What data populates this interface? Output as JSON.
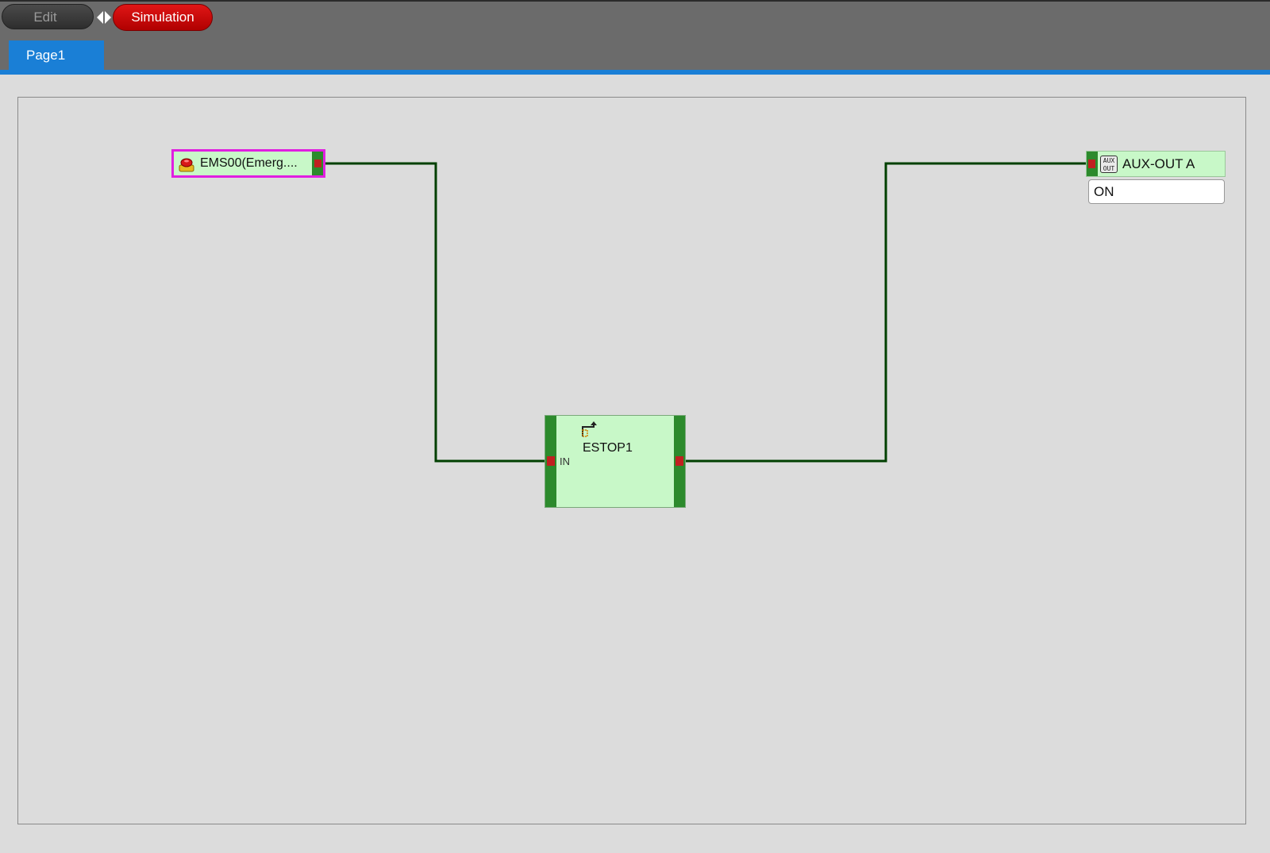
{
  "mode": {
    "edit_label": "Edit",
    "simulation_label": "Simulation"
  },
  "tabs": [
    {
      "label": "Page1"
    }
  ],
  "diagram": {
    "input_node": {
      "label": "EMS00(Emerg...."
    },
    "function_block": {
      "name": "ESTOP1",
      "input_port": "IN"
    },
    "output_node": {
      "label": "AUX-OUT A",
      "value": "ON"
    }
  },
  "colors": {
    "wire": "#004000",
    "block_fill": "#c8f8c8",
    "port_bar": "#2c8a2c",
    "port_pin": "#c02020",
    "selection": "#e020e0",
    "accent": "#1a7fd6",
    "simulation": "#d00000"
  },
  "icons": {
    "input_node": "emergency-stop-icon",
    "function_block": "estop-function-icon",
    "output_node": "aux-out-icon",
    "mode_toggle": "toggle-arrows-icon"
  }
}
